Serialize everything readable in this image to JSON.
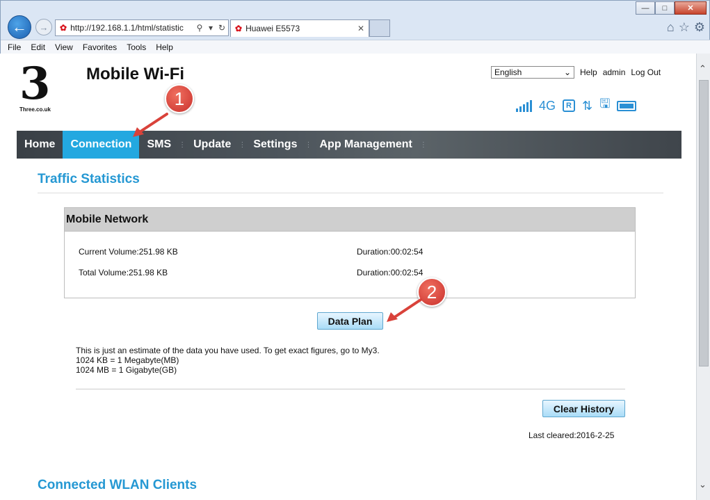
{
  "browser": {
    "address_url": "http://192.168.1.1/html/statistic",
    "tab_title": "Huawei E5573",
    "menu": [
      "File",
      "Edit",
      "View",
      "Favorites",
      "Tools",
      "Help"
    ]
  },
  "header": {
    "logo_sub": "Three.co.uk",
    "app_title": "Mobile Wi-Fi",
    "language": "English",
    "help": "Help",
    "user": "admin",
    "logout": "Log Out",
    "network_type": "4G",
    "roaming": "R"
  },
  "nav": {
    "items": [
      "Home",
      "Connection",
      "SMS",
      "Update",
      "Settings",
      "App Management"
    ],
    "active": "Connection"
  },
  "traffic": {
    "title": "Traffic Statistics",
    "panel_title": "Mobile Network",
    "current_volume": "Current Volume:251.98 KB",
    "current_duration": "Duration:00:02:54",
    "total_volume": "Total Volume:251.98 KB",
    "total_duration": "Duration:00:02:54",
    "data_plan_label": "Data Plan",
    "estimate_line1": "This is just an estimate of the data you have used. To get exact figures, go to My3.",
    "estimate_line2": "1024 KB = 1 Megabyte(MB)",
    "estimate_line3": "1024 MB = 1 Gigabyte(GB)",
    "clear_history_label": "Clear History",
    "last_cleared": "Last cleared:2016-2-25"
  },
  "wlan": {
    "title": "Connected WLAN Clients"
  },
  "annotations": {
    "marker1": "1",
    "marker2": "2",
    "color": "#d9423a"
  }
}
